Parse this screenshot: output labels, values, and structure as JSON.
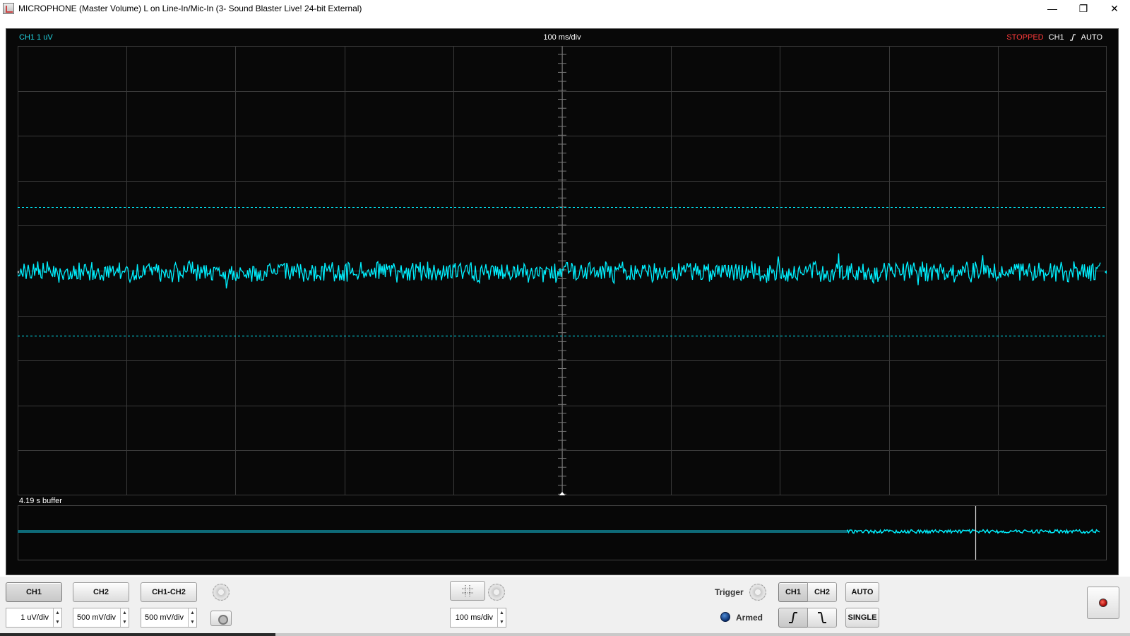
{
  "window": {
    "title": "MICROPHONE (Master Volume) L on Line-In/Mic-In (3- Sound Blaster Live! 24-bit External)",
    "minimize_glyph": "—",
    "restore_glyph": "❐",
    "close_glyph": "✕"
  },
  "scope": {
    "ch1_scale_label": "CH1 1 uV",
    "timebase_label": "100 ms/div",
    "status": "STOPPED",
    "trigger_source": "CH1",
    "trigger_mode": "AUTO",
    "buffer_label": "4.19 s buffer",
    "colors": {
      "trace": "#00f0ff",
      "grid": "#3a3a3a",
      "stopped": "#ff3b3b",
      "buffer_trace": "#0e6a78"
    }
  },
  "controls": {
    "ch1_button": "CH1",
    "ch2_button": "CH2",
    "ch1ch2_button": "CH1-CH2",
    "ch1_volts": "1 uV/div",
    "ch2_volts": "500 mV/div",
    "math_volts": "500 mV/div",
    "timebase": "100 ms/div",
    "trigger_label": "Trigger",
    "trigger_ch1": "CH1",
    "trigger_ch2": "CH2",
    "auto_button": "AUTO",
    "single_button": "SINGLE",
    "armed_label": "Armed",
    "icons": [
      "gear-icon",
      "camera-icon",
      "grid-icon",
      "rising-edge-icon",
      "falling-edge-icon",
      "record-icon"
    ]
  }
}
